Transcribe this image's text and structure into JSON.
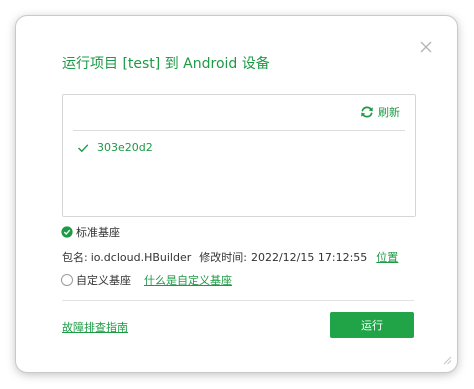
{
  "dialog": {
    "title": "运行项目 [test] 到 Android 设备",
    "close_icon": "close-icon"
  },
  "devices": {
    "refresh_label": "刷新",
    "refresh_icon": "refresh-icon",
    "items": [
      {
        "label": "303e20d2",
        "selected": true
      }
    ]
  },
  "base": {
    "standard_label": "标准基座",
    "standard_selected": true,
    "package_label": "包名:",
    "package_name": "io.dcloud.HBuilder",
    "modified_label": "修改时间:",
    "modified_time": "2022/12/15 17:12:55",
    "location_link": "位置",
    "custom_label": "自定义基座",
    "custom_selected": false,
    "custom_help_link": "什么是自定义基座"
  },
  "footer": {
    "help_link": "故障排查指南",
    "run_button": "运行"
  },
  "colors": {
    "accent": "#1d9a45",
    "button": "#21a448"
  }
}
